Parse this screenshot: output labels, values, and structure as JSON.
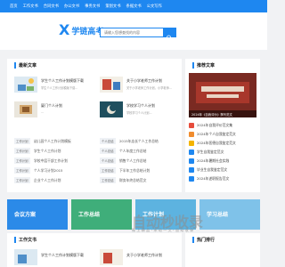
{
  "nav": [
    "首页",
    "工作文书",
    "合同文书",
    "办公文书",
    "事务文书",
    "策划文书",
    "条据文书",
    "公文写作"
  ],
  "logo": {
    "mark": "X",
    "text": "学链高考"
  },
  "search": {
    "placeholder": "请输入您想查找的内容"
  },
  "latest": {
    "title": "最新文章",
    "items": [
      {
        "title": "学生个人工作计划模版下载",
        "sub": "学生个人工作计划模版下载..."
      },
      {
        "title": "关于小学老师工作计划",
        "sub": "关于小学老师工作计划，小学老师..."
      },
      {
        "title": "厦门个人计划",
        "sub": "..."
      },
      {
        "title": "学校学习个人计划",
        "sub": "学校学习个人计划..."
      }
    ],
    "list": [
      {
        "tag": "工作计划",
        "text": "幼儿园个人工作计划模板"
      },
      {
        "tag": "工作计划",
        "text": "学生个人工作计划"
      },
      {
        "tag": "工作计划",
        "text": "学校中层干部工作计划"
      },
      {
        "tag": "工作计划",
        "text": "个人学习计划2015"
      },
      {
        "tag": "工作计划",
        "text": "企业个人工作计划"
      }
    ],
    "list2": [
      {
        "tag": "个人总结",
        "text": "2015年店长个人工作总结"
      },
      {
        "tag": "个人总结",
        "text": "个人年度工作总结"
      },
      {
        "tag": "个人总结",
        "text": "销售个人工作总结"
      },
      {
        "tag": "工作总结",
        "text": "下半年工作总结计划"
      },
      {
        "tag": "工作总结",
        "text": "财务年终总结范文"
      }
    ]
  },
  "recommend": {
    "title": "推荐文章",
    "caption": "2024年《自我评价》撰写范文",
    "rank": [
      {
        "text": "2024年自我评价范文集",
        "color": "#e64c3c"
      },
      {
        "text": "2024年个人自我鉴定范文",
        "color": "#f08c2e"
      },
      {
        "text": "2024年医德自我鉴定范文",
        "color": "#f4b400"
      },
      {
        "text": "学生自我鉴定范文",
        "color": "#1e87f0"
      },
      {
        "text": "2024年暑期社会实践",
        "color": "#1e87f0"
      },
      {
        "text": "毕业生自我鉴定范文",
        "color": "#1e87f0"
      },
      {
        "text": "2024年述职报告范文",
        "color": "#1e87f0"
      }
    ]
  },
  "banners": [
    {
      "label": "会议方案",
      "color": "#2b8ae8"
    },
    {
      "label": "工作总结",
      "color": "#3fae7a"
    },
    {
      "label": "工作计划",
      "color": "#5db3e0"
    },
    {
      "label": "学习总结",
      "color": "#7fc2e9"
    }
  ],
  "watermark": {
    "line1": "自动秒收录",
    "line2": "微 上 精 品 · 未 动 一 文 · 自 动 收 录"
  },
  "work": {
    "title": "工作文书",
    "items": [
      {
        "title": "学生个人工作计划模版下载"
      },
      {
        "title": "关于小学老师工作计划"
      }
    ]
  },
  "hot": {
    "title": "热门排行"
  }
}
